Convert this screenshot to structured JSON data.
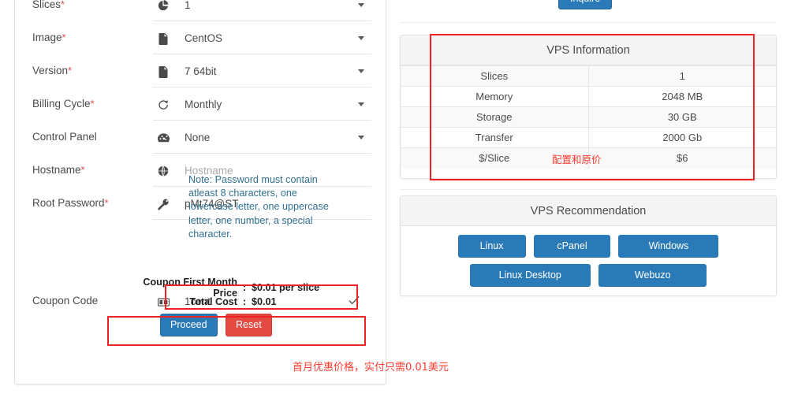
{
  "form": {
    "rows": [
      {
        "label": "Slices",
        "required": true,
        "icon": "pie-chart-icon",
        "value": "1",
        "type": "select",
        "placeholder": ""
      },
      {
        "label": "Image",
        "required": true,
        "icon": "file-icon",
        "value": "CentOS",
        "type": "select",
        "placeholder": ""
      },
      {
        "label": "Version",
        "required": true,
        "icon": "file-icon",
        "value": "7 64bit",
        "type": "select",
        "placeholder": ""
      },
      {
        "label": "Billing Cycle",
        "required": true,
        "icon": "refresh-icon",
        "value": "Monthly",
        "type": "select",
        "placeholder": ""
      },
      {
        "label": "Control Panel",
        "required": false,
        "icon": "dashboard-icon",
        "value": "None",
        "type": "select",
        "placeholder": ""
      },
      {
        "label": "Hostname",
        "required": true,
        "icon": "globe-icon",
        "value": "",
        "type": "text",
        "placeholder": "Hostname"
      },
      {
        "label": "Root Password",
        "required": true,
        "icon": "key-icon",
        "value": "pMt74@ST",
        "type": "text",
        "placeholder": ""
      },
      {
        "label": "Coupon Code",
        "required": false,
        "icon": "ticket-icon",
        "value": "1cent",
        "type": "coupon",
        "placeholder": ""
      }
    ],
    "password_note": "Note: Password must contain atleast 8 characters, one lowercase letter, one uppercase letter, one number, a special character.",
    "coupon_summary": [
      {
        "label": "Coupon First Month Price",
        "colon": ":",
        "value": "$0.01 per slice"
      },
      {
        "label": "Total Cost",
        "colon": ":",
        "value": "$0.01"
      }
    ],
    "proceed_label": "Proceed",
    "reset_label": "Reset"
  },
  "right": {
    "inquire_label": "Inquire",
    "vps_information": {
      "title": "VPS Information",
      "rows": [
        {
          "key": "Slices",
          "value": "1"
        },
        {
          "key": "Memory",
          "value": "2048 MB"
        },
        {
          "key": "Storage",
          "value": "30 GB"
        },
        {
          "key": "Transfer",
          "value": "2000 Gb"
        },
        {
          "key": "$/Slice",
          "value": "$6"
        }
      ]
    },
    "vps_recommendation": {
      "title": "VPS Recommendation",
      "buttons": [
        "Linux",
        "cPanel",
        "Windows",
        "Linux Desktop",
        "Webuzo"
      ]
    }
  },
  "annotations": {
    "table_note": "配置和原价",
    "bottom_note": "首月优惠价格，实付只需0.01美元",
    "highlight_color": "#ee2222"
  }
}
